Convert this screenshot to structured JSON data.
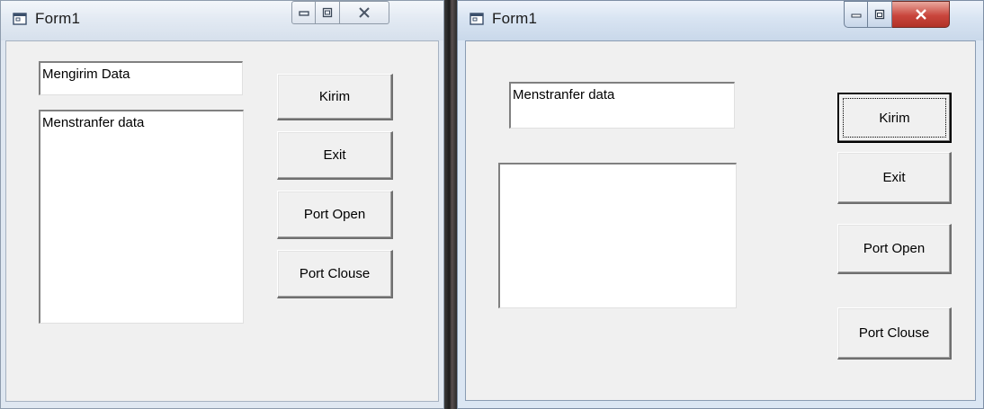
{
  "windows": [
    {
      "title": "Form1",
      "text_field_value": "Mengirim Data",
      "list_text": "Menstranfer data",
      "buttons": {
        "kirim": "Kirim",
        "exit": "Exit",
        "port_open": "Port Open",
        "port_close": "Port Clouse"
      },
      "icons": {
        "app": "form-icon",
        "minimize": "minimize-icon",
        "maximize": "maximize-icon",
        "close": "close-icon"
      }
    },
    {
      "title": "Form1",
      "text_field_value": "Menstranfer data",
      "list_text": "",
      "buttons": {
        "kirim": "Kirim",
        "exit": "Exit",
        "port_open": "Port Open",
        "port_close": "Port Clouse"
      },
      "icons": {
        "app": "form-icon",
        "minimize": "minimize-icon",
        "maximize": "maximize-icon",
        "close": "close-icon"
      }
    }
  ],
  "colors": {
    "close_button": "#c9463d",
    "client_bg": "#f0f0f0"
  }
}
